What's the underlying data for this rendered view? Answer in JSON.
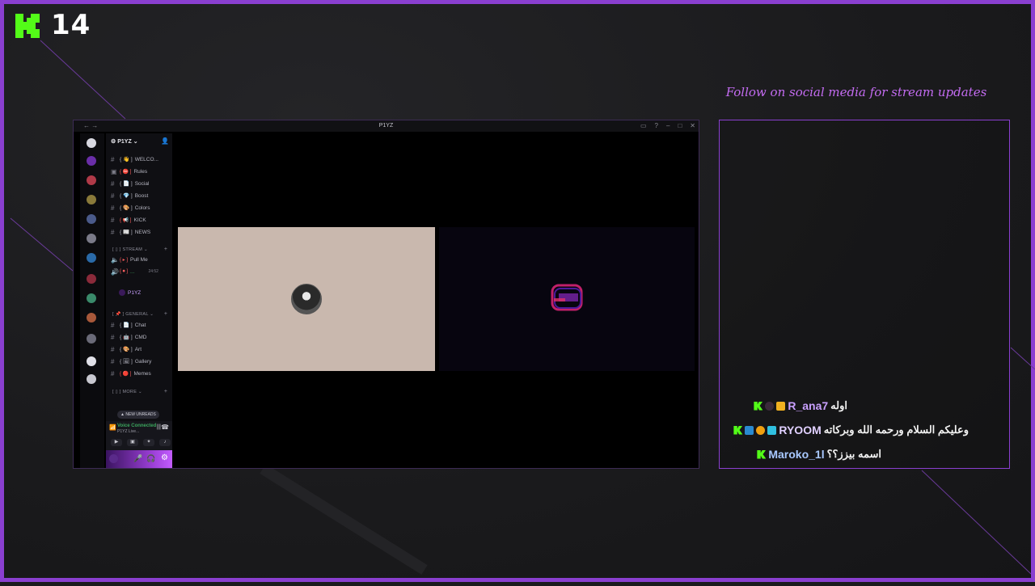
{
  "overlay": {
    "viewer_count": "14",
    "follow_text": "Follow on social media for stream updates",
    "accent_color": "#8a3fd0",
    "kick_green": "#53fc18"
  },
  "discord": {
    "window_title": "P1YZ",
    "server_name": "P1YZ",
    "channels": [
      {
        "label": "WELCO..."
      },
      {
        "label": "Rules"
      },
      {
        "label": "Social"
      },
      {
        "label": "Boost"
      },
      {
        "label": "Colors"
      },
      {
        "label": "KICK"
      },
      {
        "label": "NEWS"
      }
    ],
    "categories": {
      "stream": "STREAM",
      "general": "GENERAL",
      "more": "MORE"
    },
    "voice_channels": [
      {
        "label": "Pull Me"
      },
      {
        "label": "...",
        "timer": "24:52"
      }
    ],
    "voice_user": "P1YZ",
    "general_channels": [
      {
        "label": "Chat"
      },
      {
        "label": "CMD"
      },
      {
        "label": "Art"
      },
      {
        "label": "Gallery"
      },
      {
        "label": "Memes"
      }
    ],
    "new_unreads": "NEW UNREADS",
    "voice_status": "Voice Connected",
    "voice_sub": "P1YZ Live..."
  },
  "chat": {
    "messages": [
      {
        "user": "R_ana7",
        "user_color": "#c9a0ff",
        "message": "اوله"
      },
      {
        "user": "RYOOM",
        "user_color": "#e0d0ff",
        "message": "وعليكم السلام ورحمه الله وبركاته"
      },
      {
        "user": "Maroko_1l",
        "user_color": "#a8c8ff",
        "message": "اسمه بيزز؟؟"
      }
    ]
  }
}
